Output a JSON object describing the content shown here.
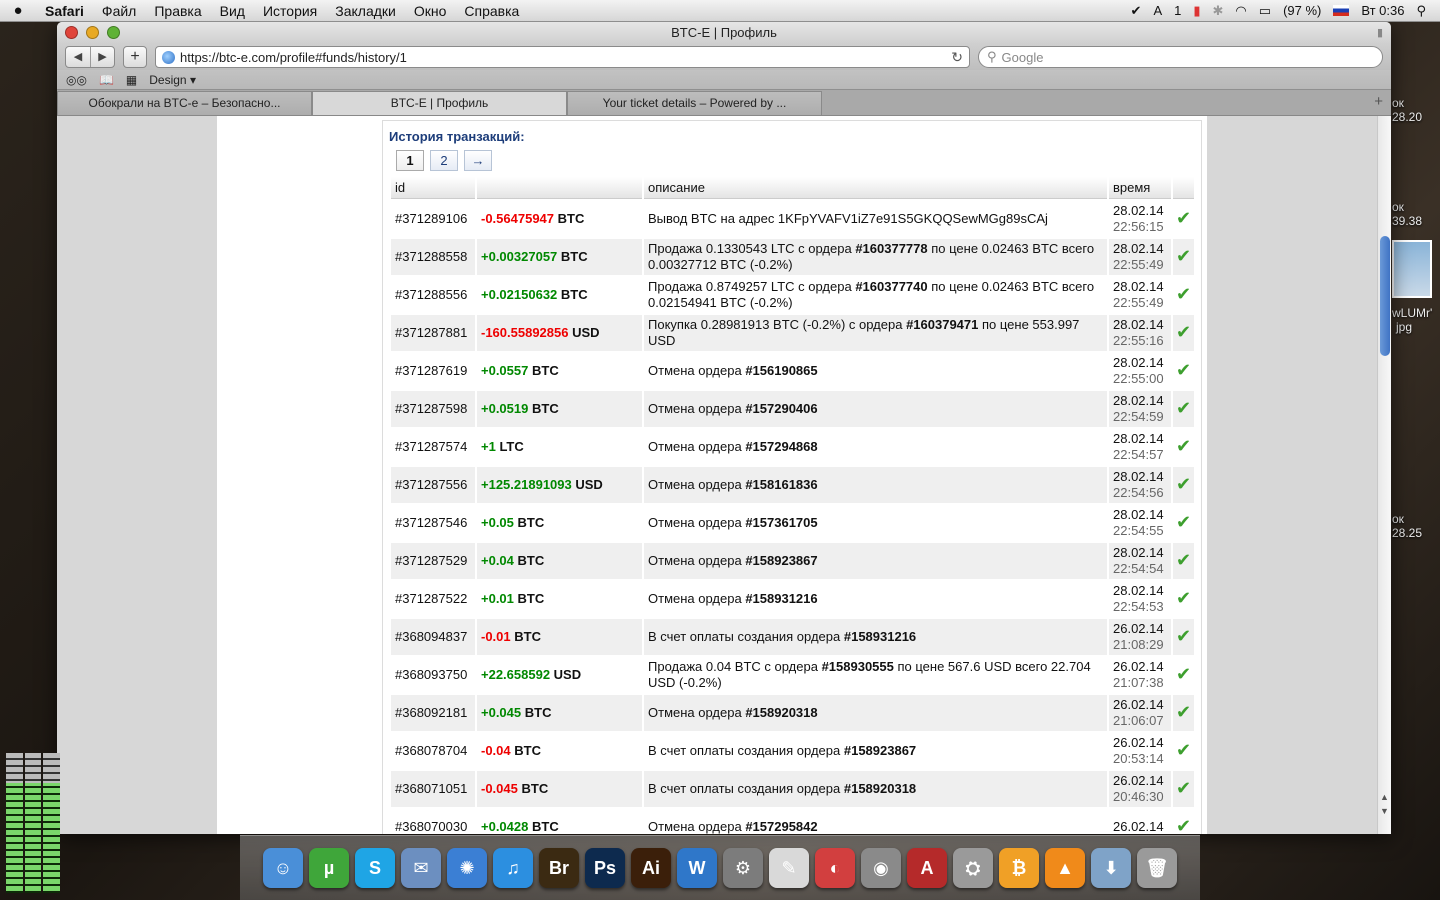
{
  "menubar": {
    "app": "Safari",
    "items": [
      "Файл",
      "Правка",
      "Вид",
      "История",
      "Закладки",
      "Окно",
      "Справка"
    ],
    "ai_count": "1",
    "battery": "(97 %)",
    "clock": "Вт 0:36"
  },
  "window": {
    "title": "BTC-E | Профиль",
    "url": "https://btc-e.com/profile#funds/history/1",
    "search_placeholder": "Google",
    "bookmark_design": "Design ▾",
    "tabs": [
      {
        "label": "Обокрали на BTC-e – Безопасно..."
      },
      {
        "label": "BTC-E | Профиль"
      },
      {
        "label": "Your ticket details – Powered by ..."
      }
    ]
  },
  "history": {
    "title": "История транзакций:",
    "pages": [
      "1",
      "2",
      "→"
    ],
    "headers": {
      "id": "id",
      "amount": "",
      "desc": "описание",
      "time": "время"
    },
    "rows": [
      {
        "id": "#371289106",
        "amt": "-0.56475947",
        "cur": "BTC",
        "sign": "neg",
        "d1": "Вывод BTC на адрес 1KFpYVAFV1iZ7e91S5GKQQSewMGg89sCAj",
        "bold": "",
        "d2": "",
        "date": "28.02.14",
        "time": "22:56:15"
      },
      {
        "id": "#371288558",
        "amt": "+0.00327057",
        "cur": "BTC",
        "sign": "pos",
        "d1": "Продажа 0.1330543 LTC с ордера ",
        "bold": "#160377778",
        "d2": " по цене 0.02463 BTC всего 0.00327712 BTC (-0.2%)",
        "date": "28.02.14",
        "time": "22:55:49"
      },
      {
        "id": "#371288556",
        "amt": "+0.02150632",
        "cur": "BTC",
        "sign": "pos",
        "d1": "Продажа 0.8749257 LTC с ордера ",
        "bold": "#160377740",
        "d2": " по цене 0.02463 BTC всего 0.02154941 BTC (-0.2%)",
        "date": "28.02.14",
        "time": "22:55:49"
      },
      {
        "id": "#371287881",
        "amt": "-160.55892856",
        "cur": "USD",
        "sign": "neg",
        "d1": "Покупка 0.28981913 BTC (-0.2%) с ордера ",
        "bold": "#160379471",
        "d2": " по цене 553.997 USD",
        "date": "28.02.14",
        "time": "22:55:16"
      },
      {
        "id": "#371287619",
        "amt": "+0.0557",
        "cur": "BTC",
        "sign": "pos",
        "d1": "Отмена ордера ",
        "bold": "#156190865",
        "d2": "",
        "date": "28.02.14",
        "time": "22:55:00"
      },
      {
        "id": "#371287598",
        "amt": "+0.0519",
        "cur": "BTC",
        "sign": "pos",
        "d1": "Отмена ордера ",
        "bold": "#157290406",
        "d2": "",
        "date": "28.02.14",
        "time": "22:54:59"
      },
      {
        "id": "#371287574",
        "amt": "+1",
        "cur": "LTC",
        "sign": "pos",
        "d1": "Отмена ордера ",
        "bold": "#157294868",
        "d2": "",
        "date": "28.02.14",
        "time": "22:54:57"
      },
      {
        "id": "#371287556",
        "amt": "+125.21891093",
        "cur": "USD",
        "sign": "pos",
        "d1": "Отмена ордера ",
        "bold": "#158161836",
        "d2": "",
        "date": "28.02.14",
        "time": "22:54:56"
      },
      {
        "id": "#371287546",
        "amt": "+0.05",
        "cur": "BTC",
        "sign": "pos",
        "d1": "Отмена ордера ",
        "bold": "#157361705",
        "d2": "",
        "date": "28.02.14",
        "time": "22:54:55"
      },
      {
        "id": "#371287529",
        "amt": "+0.04",
        "cur": "BTC",
        "sign": "pos",
        "d1": "Отмена ордера ",
        "bold": "#158923867",
        "d2": "",
        "date": "28.02.14",
        "time": "22:54:54"
      },
      {
        "id": "#371287522",
        "amt": "+0.01",
        "cur": "BTC",
        "sign": "pos",
        "d1": "Отмена ордера ",
        "bold": "#158931216",
        "d2": "",
        "date": "28.02.14",
        "time": "22:54:53"
      },
      {
        "id": "#368094837",
        "amt": "-0.01",
        "cur": "BTC",
        "sign": "neg",
        "d1": "В счет оплаты создания ордера ",
        "bold": "#158931216",
        "d2": "",
        "date": "26.02.14",
        "time": "21:08:29"
      },
      {
        "id": "#368093750",
        "amt": "+22.658592",
        "cur": "USD",
        "sign": "pos",
        "d1": "Продажа 0.04 BTC с ордера ",
        "bold": "#158930555",
        "d2": " по цене 567.6 USD всего 22.704 USD (-0.2%)",
        "date": "26.02.14",
        "time": "21:07:38"
      },
      {
        "id": "#368092181",
        "amt": "+0.045",
        "cur": "BTC",
        "sign": "pos",
        "d1": "Отмена ордера ",
        "bold": "#158920318",
        "d2": "",
        "date": "26.02.14",
        "time": "21:06:07"
      },
      {
        "id": "#368078704",
        "amt": "-0.04",
        "cur": "BTC",
        "sign": "neg",
        "d1": "В счет оплаты создания ордера ",
        "bold": "#158923867",
        "d2": "",
        "date": "26.02.14",
        "time": "20:53:14"
      },
      {
        "id": "#368071051",
        "amt": "-0.045",
        "cur": "BTC",
        "sign": "neg",
        "d1": "В счет оплаты создания ордера ",
        "bold": "#158920318",
        "d2": "",
        "date": "26.02.14",
        "time": "20:46:30"
      },
      {
        "id": "#368070030",
        "amt": "+0.0428",
        "cur": "BTC",
        "sign": "pos",
        "d1": "Отмена ордера ",
        "bold": "#157295842",
        "d2": "",
        "date": "26.02.14",
        "time": ""
      }
    ]
  },
  "desktop": {
    "labels": [
      "ок",
      "28.20",
      "ок",
      "39.38",
      "wLUMr'",
      "jpg",
      "ок",
      "28.25"
    ]
  },
  "dock": {
    "items": [
      {
        "icon": "finder-icon",
        "glyph": "☺",
        "color": "#4a8fd8"
      },
      {
        "icon": "utorrent-icon",
        "glyph": "µ",
        "color": "#3fa63a"
      },
      {
        "icon": "skype-icon",
        "glyph": "S",
        "color": "#1fa5e5"
      },
      {
        "icon": "mail-icon",
        "glyph": "✉",
        "color": "#6c8fc0"
      },
      {
        "icon": "safari-icon",
        "glyph": "✺",
        "color": "#3b7fd4"
      },
      {
        "icon": "itunes-icon",
        "glyph": "♫",
        "color": "#2c8fe0"
      },
      {
        "icon": "bridge-icon",
        "glyph": "Br",
        "color": "#3b2a12"
      },
      {
        "icon": "photoshop-icon",
        "glyph": "Ps",
        "color": "#0d2a4e"
      },
      {
        "icon": "illustrator-icon",
        "glyph": "Ai",
        "color": "#3b1f0a"
      },
      {
        "icon": "word-icon",
        "glyph": "W",
        "color": "#2f77c9"
      },
      {
        "icon": "system-preferences-icon",
        "glyph": "⚙",
        "color": "#7c7c7c"
      },
      {
        "icon": "textedit-icon",
        "glyph": "✎",
        "color": "#d9d9d9"
      },
      {
        "icon": "color-wheel-icon",
        "glyph": "◐",
        "color": "#d23f3f"
      },
      {
        "icon": "camera-icon",
        "glyph": "◉",
        "color": "#8a8a8a"
      },
      {
        "icon": "autocad-icon",
        "glyph": "A",
        "color": "#b52a2a"
      },
      {
        "icon": "disk-utility-icon",
        "glyph": "⛭",
        "color": "#9a9a9a"
      },
      {
        "icon": "bitcoin-icon",
        "glyph": "₿",
        "color": "#f0a026"
      },
      {
        "icon": "vlc-icon",
        "glyph": "▲",
        "color": "#f08a1a"
      },
      {
        "icon": "downloads-folder-icon",
        "glyph": "⬇",
        "color": "#7fa3c8"
      },
      {
        "icon": "trash-icon",
        "glyph": "🗑",
        "color": "#9a9a9a"
      }
    ]
  }
}
